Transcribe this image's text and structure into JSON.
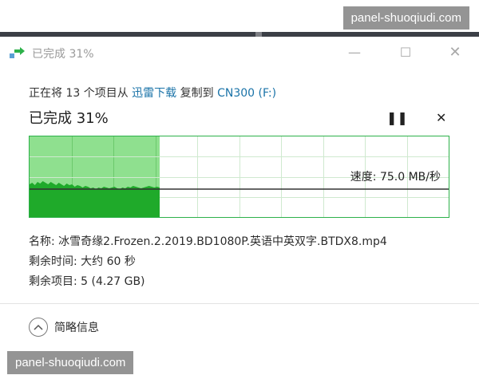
{
  "watermark_text": "panel-shuoqiudi.com",
  "window": {
    "title": "已完成 31%",
    "icon": "copy-arrow-icon",
    "min_symbol": "—",
    "max_symbol": "☐",
    "close_symbol": "✕"
  },
  "copy_status": {
    "prefix": "正在将 13 个项目从",
    "source": "迅雷下载",
    "middle": "复制到",
    "destination": "CN300 (F:)"
  },
  "progress": {
    "label": "已完成 31%",
    "percent": 31,
    "pause_symbol": "❚❚",
    "stop_symbol": "✕"
  },
  "graph": {
    "speed_text": "速度: 75.0 MB/秒",
    "accent": "#2db14a"
  },
  "details": {
    "name_text": "名称: 冰雪奇缘2.Frozen.2.2019.BD1080P.英语中英双字.BTDX8.mp4",
    "time_text": "剩余时间: 大约 60 秒",
    "items_text": "剩余项目: 5 (4.27 GB)"
  },
  "footer": {
    "toggle_label": "简略信息",
    "toggle_icon": "chevron-up-icon"
  }
}
